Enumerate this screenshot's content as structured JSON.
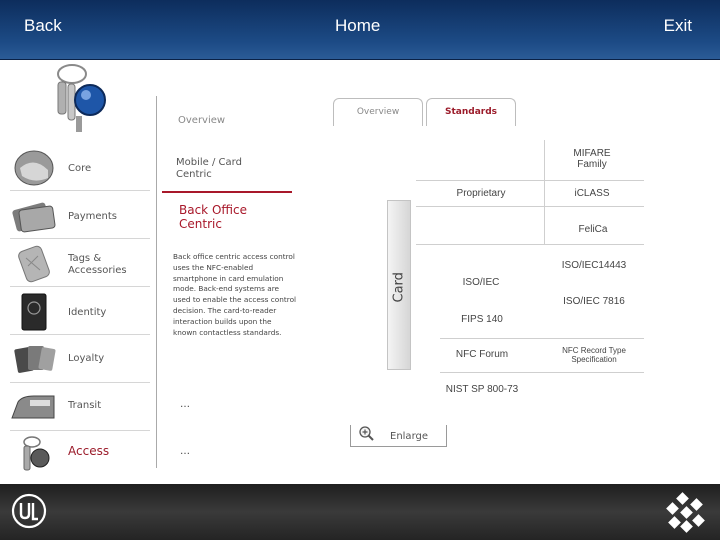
{
  "topbar": {
    "back_label": "Back",
    "home_label": "Home",
    "exit_label": "Exit"
  },
  "sidebar": {
    "items": [
      {
        "label": "Core",
        "icon": "helmet-icon"
      },
      {
        "label": "Payments",
        "icon": "credit-cards-icon"
      },
      {
        "label": "Tags &\nAccessories",
        "icon": "tag-icon"
      },
      {
        "label": "Identity",
        "icon": "passport-icon"
      },
      {
        "label": "Loyalty",
        "icon": "loyalty-cards-icon"
      },
      {
        "label": "Transit",
        "icon": "train-icon"
      },
      {
        "label": "Access",
        "icon": "key-icon"
      }
    ]
  },
  "middle": {
    "overview_label": "Overview",
    "mobile_card_label": "Mobile / Card\nCentric",
    "back_office_title": "Back Office\nCentric",
    "description": "Back office centric access control uses the NFC-enabled smartphone in card emulation mode.  Back-end systems are used to enable the access control decision. The card-to-reader interaction builds upon the known contactless standards.",
    "ellipsis_1": "…",
    "ellipsis_2": "…"
  },
  "tabs": {
    "overview": "Overview",
    "standards": "Standards"
  },
  "standards_panel": {
    "card_label": "Card",
    "items": {
      "mifare": "MIFARE\nFamily",
      "proprietary": "Proprietary",
      "iclass": "iCLASS",
      "felica": "FeliCa",
      "iso14443": "ISO/IEC14443",
      "iso_iec": "ISO/IEC",
      "iso7816": "ISO/IEC 7816",
      "fips": "FIPS 140",
      "nfc_forum": "NFC Forum",
      "nfc_record": "NFC Record Type\nSpecification",
      "nist": "NIST SP 800-73"
    }
  },
  "enlarge_label": "Enlarge",
  "colors": {
    "accent_red": "#a8182a",
    "topbar_blue": "#1c4a85",
    "bottombar": "#2e2e2e"
  }
}
